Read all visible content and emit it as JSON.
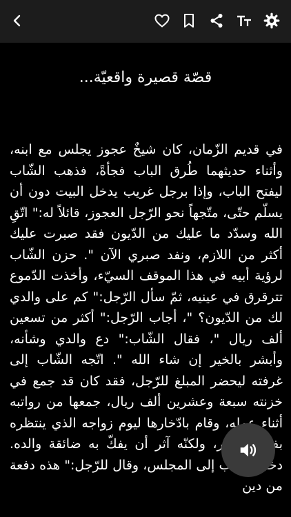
{
  "toolbar": {
    "icons": [
      "back-icon",
      "heart-icon",
      "bookmark-icon",
      "share-icon",
      "text-size-icon",
      "settings-icon"
    ]
  },
  "story": {
    "title": "قصّة قصيرة واقعيّة...",
    "text": "في قديم الزّمان، كان شيخٌ عجوز يجلس مع ابنه، وأثناء حديثهما طُرق الباب فجأةً، فذهب الشّاب ليفتح الباب، وإذا برجل غريب يدخل البيت دون أن يسلّم حتّى، متّجهاً نحو الرّجل العجوز، قائلاً له:\" اتّقِ الله وسدّد ما عليك من الدّيون فقد صبرت عليك أكثر من اللازم، ونفد صبري الآن \". حزن الشّاب لرؤية أبيه في هذا الموقف السيّء، وأخذت الدّموع تترقرق في عينيه، ثمّ سأل الرّجل:\" كم على والدي لك من الدّيون؟ \"، أجاب الرّجل:\" أكثر من تسعين ألف ريال \"، فقال الشّاب:\" دع والدي وشأنه، وأبشر بالخير إن شاء الله \". اتّجه الشّاب إلى غرفته ليحضر المبلغ للرّجل، فقد كان قد جمع في خزنته سبعة وعشرين ألف ريال، جمعها من رواتبه أثناء عمله، وقام بادّخارها ليوم زواجه الذي ينتظره بفارغ الصّبر، ولكنّه آثر أن يفكّ به ضائقة والده. دخل الشّاب إلى المجلس، وقال للرّجل:\" هذه دفعة من دين"
  }
}
